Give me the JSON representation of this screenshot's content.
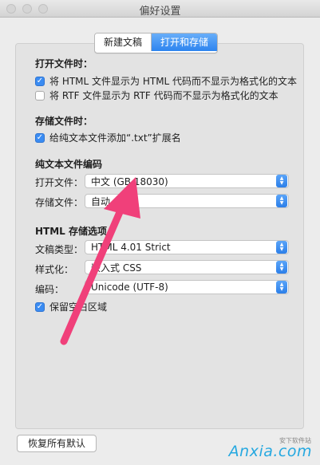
{
  "window": {
    "title": "偏好设置"
  },
  "tabs": [
    {
      "label": "新建文稿",
      "active": false
    },
    {
      "label": "打开和存储",
      "active": true
    }
  ],
  "open_files": {
    "heading": "打开文件时：",
    "options": [
      {
        "label": "将 HTML 文件显示为 HTML 代码而不显示为格式化的文本",
        "checked": true
      },
      {
        "label": "将 RTF 文件显示为 RTF 代码而不显示为格式化的文本",
        "checked": false
      }
    ]
  },
  "save_files": {
    "heading": "存储文件时：",
    "options": [
      {
        "label": "给纯文本文件添加“.txt”扩展名",
        "checked": true
      }
    ]
  },
  "encoding": {
    "heading": "纯文本文件编码",
    "open_label": "打开文件：",
    "open_value": "中文 (GB 18030)",
    "save_label": "存储文件：",
    "save_value": "自动"
  },
  "html_save": {
    "heading": "HTML 存储选项",
    "doctype_label": "文稿类型：",
    "doctype_value": "HTML 4.01 Strict",
    "styling_label": "样式化：",
    "styling_value": "嵌入式 CSS",
    "encoding_label": "编码：",
    "encoding_value": "Unicode (UTF-8)",
    "preserve_option": {
      "label": "保留空白区域",
      "checked": true
    }
  },
  "footer": {
    "restore_defaults": "恢复所有默认"
  },
  "watermark": {
    "logo_text": "Anxia.com",
    "sub_text": "安下软件站"
  },
  "colors": {
    "accent": "#2d84ef",
    "annotation_arrow": "#f0407a"
  },
  "icons": {
    "checkbox_checked": "checkmark-icon",
    "select_arrows": "up-down-chevron-icon"
  }
}
